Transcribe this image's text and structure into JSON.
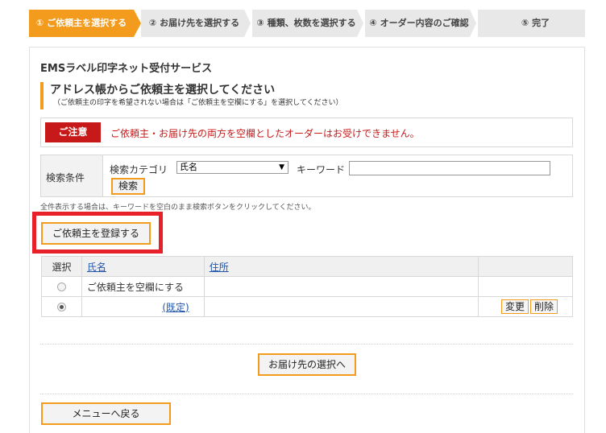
{
  "steps": [
    {
      "label": "① ご依頼主を選択する",
      "active": true
    },
    {
      "label": "② お届け先を選択する",
      "active": false
    },
    {
      "label": "③ 種類、枚数を選択する",
      "active": false
    },
    {
      "label": "④ オーダー内容のご確認",
      "active": false
    },
    {
      "label": "⑤ 完了",
      "active": false
    }
  ],
  "app_title": "EMSラベル印字ネット受付サービス",
  "section": {
    "title": "アドレス帳からご依頼主を選択してください",
    "subtitle": "（ご依頼主の印字を希望されない場合は「ご依頼主を空欄にする」を選択してください）"
  },
  "notice": {
    "badge": "ご注意",
    "text": "ご依頼主・お届け先の両方を空欄としたオーダーはお受けできません。"
  },
  "search": {
    "condition_label": "検索条件",
    "category_label": "検索カテゴリ",
    "category_value": "氏名",
    "keyword_label": "キーワード",
    "keyword_value": "",
    "button_label": "検索",
    "hint": "全件表示する場合は、キーワードを空白のまま検索ボタンをクリックしてください。"
  },
  "register_button": "ご依頼主を登録する",
  "table": {
    "headers": {
      "select": "選択",
      "name": "氏名",
      "address": "住所",
      "actions": ""
    },
    "rows": [
      {
        "selected": false,
        "name": "ご依頼主を空欄にする",
        "address": "",
        "actions": []
      },
      {
        "selected": true,
        "name": "(既定)",
        "address": "",
        "actions": [
          "変更",
          "削除"
        ]
      }
    ]
  },
  "next_button": "お届け先の選択へ",
  "back_button": "メニューへ戻る",
  "colors": {
    "accent": "#f29b1d",
    "alert": "#c71919",
    "highlight": "#e8202a"
  }
}
